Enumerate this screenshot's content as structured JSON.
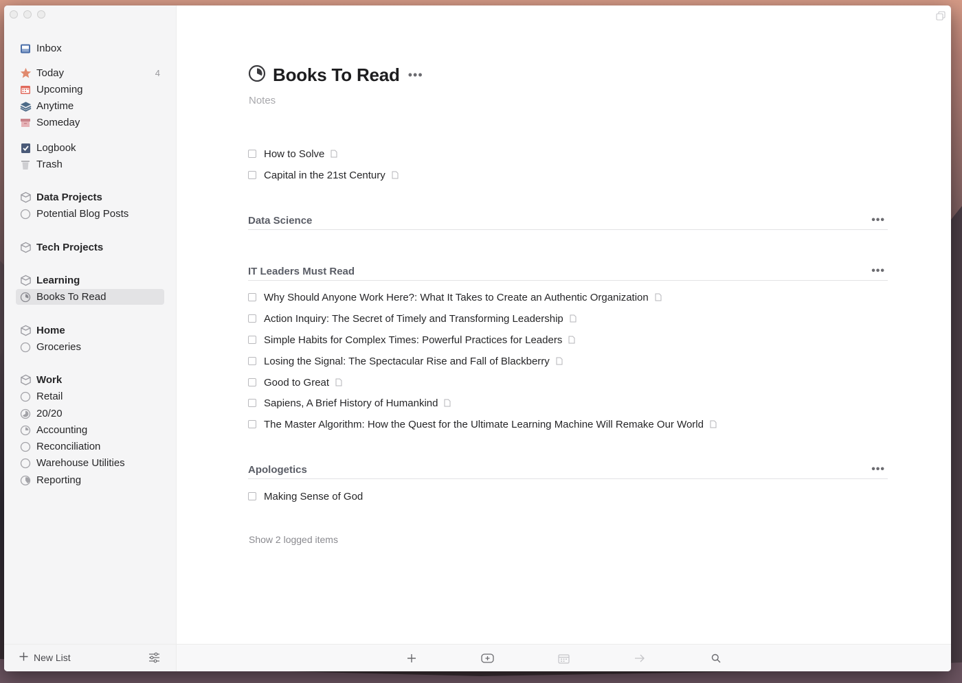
{
  "sidebar": {
    "items": [
      {
        "label": "Inbox",
        "icon": "inbox-icon"
      },
      {
        "label": "Today",
        "icon": "star-icon",
        "count": "4"
      },
      {
        "label": "Upcoming",
        "icon": "calendar-icon"
      },
      {
        "label": "Anytime",
        "icon": "layers-icon"
      },
      {
        "label": "Someday",
        "icon": "box-icon"
      },
      {
        "label": "Logbook",
        "icon": "logbook-icon"
      },
      {
        "label": "Trash",
        "icon": "trash-icon"
      },
      {
        "label": "Data Projects",
        "icon": "area-icon"
      },
      {
        "label": "Potential Blog Posts",
        "icon": "project-circle-icon"
      },
      {
        "label": "Tech Projects",
        "icon": "area-icon"
      },
      {
        "label": "Learning",
        "icon": "area-icon"
      },
      {
        "label": "Books To Read",
        "icon": "project-progress-icon"
      },
      {
        "label": "Home",
        "icon": "area-icon"
      },
      {
        "label": "Groceries",
        "icon": "project-circle-icon"
      },
      {
        "label": "Work",
        "icon": "area-icon"
      },
      {
        "label": "Retail",
        "icon": "project-circle-icon"
      },
      {
        "label": "20/20",
        "icon": "project-progress-icon"
      },
      {
        "label": "Accounting",
        "icon": "project-progress-icon"
      },
      {
        "label": "Reconciliation",
        "icon": "project-circle-icon"
      },
      {
        "label": "Warehouse Utilities",
        "icon": "project-circle-icon"
      },
      {
        "label": "Reporting",
        "icon": "project-progress-icon"
      }
    ],
    "new_list_label": "New List"
  },
  "project": {
    "title": "Books To Read",
    "more": "•••",
    "notes_placeholder": "Notes",
    "tasks": [
      {
        "label": "How to Solve"
      },
      {
        "label": "Capital in the 21st Century"
      }
    ],
    "headings": [
      {
        "label": "Data Science",
        "more": "•••",
        "tasks": []
      },
      {
        "label": "IT Leaders Must Read",
        "more": "•••",
        "tasks": [
          {
            "label": "Why Should Anyone Work Here?: What It Takes to Create an Authentic Organization"
          },
          {
            "label": "Action Inquiry: The Secret of Timely and Transforming Leadership"
          },
          {
            "label": "Simple Habits for Complex Times: Powerful Practices for Leaders"
          },
          {
            "label": "Losing the Signal: The Spectacular Rise and Fall of Blackberry"
          },
          {
            "label": "Good to Great"
          },
          {
            "label": "Sapiens, A Brief History of Humankind"
          },
          {
            "label": "The Master Algorithm: How the Quest for the Ultimate Learning Machine Will Remake Our World"
          }
        ]
      },
      {
        "label": "Apologetics",
        "more": "•••",
        "tasks": [
          {
            "label": "Making Sense of God"
          }
        ]
      }
    ],
    "logged_label": "Show 2 logged items"
  },
  "toolbar": {
    "buttons": [
      "add-task-icon",
      "add-heading-icon",
      "when-calendar-icon",
      "move-arrow-icon",
      "search-icon"
    ]
  },
  "colors": {
    "accent_star": "#e08a6e",
    "calendar_red": "#e06a5c",
    "selected_bg": "#e3e3e5"
  }
}
